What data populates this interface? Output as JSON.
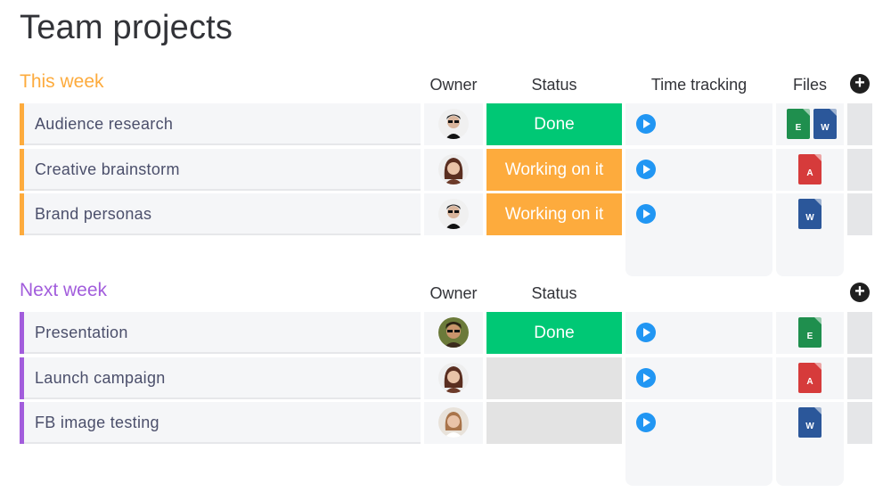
{
  "page": {
    "title": "Team projects"
  },
  "colors": {
    "done": "#00c875",
    "working": "#fdab3d",
    "empty": "#e3e3e3",
    "this_week": "#fdab3d",
    "next_week": "#a25ddc",
    "excel": "#1f8f4e",
    "word": "#2b579a",
    "acrobat": "#d63b3b"
  },
  "groups": [
    {
      "name": "This week",
      "columns": {
        "owner": "Owner",
        "status": "Status",
        "time": "Time tracking",
        "files": "Files"
      },
      "items": [
        {
          "name": "Audience research",
          "avatar": "avatar-man-glasses",
          "status": "Done",
          "status_kind": "done",
          "files": [
            "E",
            "W"
          ]
        },
        {
          "name": "Creative brainstorm",
          "avatar": "avatar-woman-hair",
          "status": "Working on it",
          "status_kind": "working",
          "files": [
            "A"
          ]
        },
        {
          "name": "Brand personas",
          "avatar": "avatar-man-glasses",
          "status": "Working on it",
          "status_kind": "working",
          "files": [
            "W"
          ]
        }
      ]
    },
    {
      "name": "Next week",
      "columns": {
        "owner": "Owner",
        "status": "Status",
        "time": "",
        "files": ""
      },
      "items": [
        {
          "name": "Presentation",
          "avatar": "avatar-man-sunglasses",
          "status": "Done",
          "status_kind": "done",
          "files": [
            "E"
          ]
        },
        {
          "name": "Launch campaign",
          "avatar": "avatar-woman-hair",
          "status": "",
          "status_kind": "empty",
          "files": [
            "A"
          ]
        },
        {
          "name": "FB image testing",
          "avatar": "avatar-woman-blonde",
          "status": "",
          "status_kind": "empty",
          "files": [
            "W"
          ]
        }
      ]
    }
  ]
}
